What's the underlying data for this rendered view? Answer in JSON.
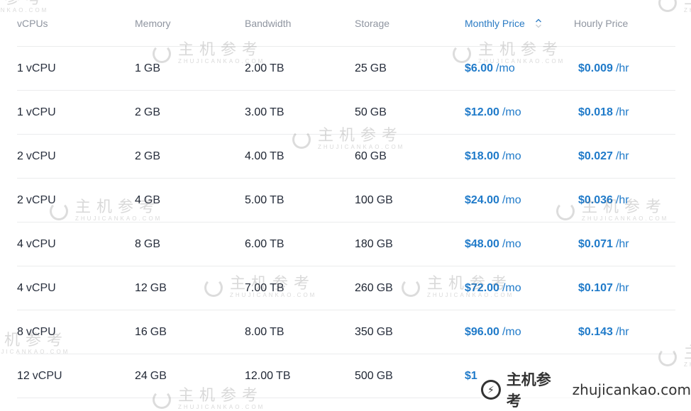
{
  "table": {
    "headers": [
      {
        "label": "vCPUs",
        "active": false
      },
      {
        "label": "Memory",
        "active": false
      },
      {
        "label": "Bandwidth",
        "active": false
      },
      {
        "label": "Storage",
        "active": false
      },
      {
        "label": "Monthly Price",
        "active": true,
        "sort_icon": "sort-chevrons-icon"
      },
      {
        "label": "Hourly Price",
        "active": false
      }
    ],
    "rows": [
      {
        "vcpu": "1",
        "vcpu_unit": "vCPU",
        "memory": "1",
        "memory_unit": "GB",
        "bandwidth": "2.00",
        "bandwidth_unit": "TB",
        "storage": "25",
        "storage_unit": "GB",
        "monthly": "$6.00",
        "monthly_unit": "/mo",
        "hourly": "$0.009",
        "hourly_unit": "/hr"
      },
      {
        "vcpu": "1",
        "vcpu_unit": "vCPU",
        "memory": "2",
        "memory_unit": "GB",
        "bandwidth": "3.00",
        "bandwidth_unit": "TB",
        "storage": "50",
        "storage_unit": "GB",
        "monthly": "$12.00",
        "monthly_unit": "/mo",
        "hourly": "$0.018",
        "hourly_unit": "/hr"
      },
      {
        "vcpu": "2",
        "vcpu_unit": "vCPU",
        "memory": "2",
        "memory_unit": "GB",
        "bandwidth": "4.00",
        "bandwidth_unit": "TB",
        "storage": "60",
        "storage_unit": "GB",
        "monthly": "$18.00",
        "monthly_unit": "/mo",
        "hourly": "$0.027",
        "hourly_unit": "/hr"
      },
      {
        "vcpu": "2",
        "vcpu_unit": "vCPU",
        "memory": "4",
        "memory_unit": "GB",
        "bandwidth": "5.00",
        "bandwidth_unit": "TB",
        "storage": "100",
        "storage_unit": "GB",
        "monthly": "$24.00",
        "monthly_unit": "/mo",
        "hourly": "$0.036",
        "hourly_unit": "/hr"
      },
      {
        "vcpu": "4",
        "vcpu_unit": "vCPU",
        "memory": "8",
        "memory_unit": "GB",
        "bandwidth": "6.00",
        "bandwidth_unit": "TB",
        "storage": "180",
        "storage_unit": "GB",
        "monthly": "$48.00",
        "monthly_unit": "/mo",
        "hourly": "$0.071",
        "hourly_unit": "/hr"
      },
      {
        "vcpu": "4",
        "vcpu_unit": "vCPU",
        "memory": "12",
        "memory_unit": "GB",
        "bandwidth": "7.00",
        "bandwidth_unit": "TB",
        "storage": "260",
        "storage_unit": "GB",
        "monthly": "$72.00",
        "monthly_unit": "/mo",
        "hourly": "$0.107",
        "hourly_unit": "/hr"
      },
      {
        "vcpu": "8",
        "vcpu_unit": "vCPU",
        "memory": "16",
        "memory_unit": "GB",
        "bandwidth": "8.00",
        "bandwidth_unit": "TB",
        "storage": "350",
        "storage_unit": "GB",
        "monthly": "$96.00",
        "monthly_unit": "/mo",
        "hourly": "$0.143",
        "hourly_unit": "/hr"
      },
      {
        "vcpu": "12",
        "vcpu_unit": "vCPU",
        "memory": "24",
        "memory_unit": "GB",
        "bandwidth": "12.00",
        "bandwidth_unit": "TB",
        "storage": "500",
        "storage_unit": "GB",
        "monthly": "$1",
        "monthly_unit": "",
        "hourly": "",
        "hourly_unit": ""
      }
    ]
  },
  "watermark": {
    "cn": "主机参考",
    "en": "ZHUJICANKAO.COM",
    "brand_cn": "主机参考",
    "brand_url": "zhujicankao.com"
  },
  "colors": {
    "accent": "#1f7ac9",
    "header_text": "#8f95a0",
    "divider": "#ebeced"
  }
}
